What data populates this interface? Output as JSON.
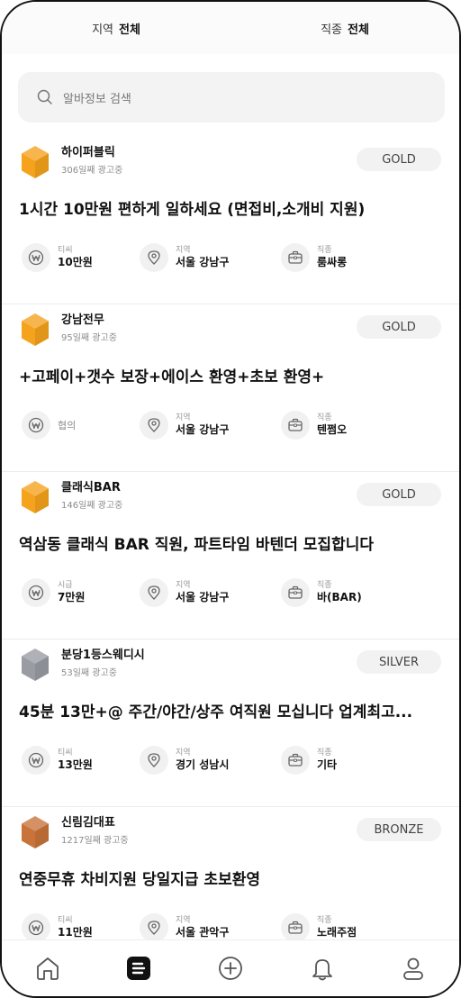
{
  "filters": {
    "region": {
      "label": "지역",
      "value": "전체"
    },
    "category": {
      "label": "직종",
      "value": "전체"
    }
  },
  "search": {
    "placeholder": "알바정보 검색"
  },
  "listings": [
    {
      "company": "하이퍼블릭",
      "days": "306일째 광고중",
      "tier": "GOLD",
      "title": "1시간 10만원 편하게 일하세요 (면접비,소개비 지원)",
      "pay": {
        "label": "티씨",
        "value": "10만원"
      },
      "region": {
        "label": "지역",
        "value": "서울 강남구"
      },
      "category": {
        "label": "직종",
        "value": "룸싸롱"
      }
    },
    {
      "company": "강남전무",
      "days": "95일째 광고중",
      "tier": "GOLD",
      "title": "+고페이+갯수 보장+에이스 환영+초보 환영+",
      "pay": {
        "label": "",
        "value": "협의"
      },
      "region": {
        "label": "지역",
        "value": "서울 강남구"
      },
      "category": {
        "label": "직종",
        "value": "텐쩜오"
      }
    },
    {
      "company": "클래식BAR",
      "days": "146일째 광고중",
      "tier": "GOLD",
      "title": "역삼동 클래식 BAR 직원, 파트타임 바텐더 모집합니다",
      "pay": {
        "label": "시급",
        "value": "7만원"
      },
      "region": {
        "label": "지역",
        "value": "서울 강남구"
      },
      "category": {
        "label": "직종",
        "value": "바(BAR)"
      }
    },
    {
      "company": "분당1등스웨디시",
      "days": "53일째 광고중",
      "tier": "SILVER",
      "title": "45분 13만+@ 주간/야간/상주 여직원 모십니다 업계최고...",
      "pay": {
        "label": "티씨",
        "value": "13만원"
      },
      "region": {
        "label": "지역",
        "value": "경기 성남시"
      },
      "category": {
        "label": "직종",
        "value": "기타"
      }
    },
    {
      "company": "신림김대표",
      "days": "1217일째 광고중",
      "tier": "BRONZE",
      "title": "연중무휴 차비지원 당일지급 초보환영",
      "pay": {
        "label": "티씨",
        "value": "11만원"
      },
      "region": {
        "label": "지역",
        "value": "서울 관악구"
      },
      "category": {
        "label": "직종",
        "value": "노래주점"
      }
    }
  ],
  "tier_colors": {
    "GOLD": "#f5a21c",
    "SILVER": "#9a9ca3",
    "BRONZE": "#c8733a"
  },
  "tabbar": {
    "items": [
      {
        "icon": "home-icon",
        "active": false
      },
      {
        "icon": "list-icon",
        "active": true
      },
      {
        "icon": "add-icon",
        "active": false
      },
      {
        "icon": "bell-icon",
        "active": false
      },
      {
        "icon": "profile-icon",
        "active": false
      }
    ]
  }
}
